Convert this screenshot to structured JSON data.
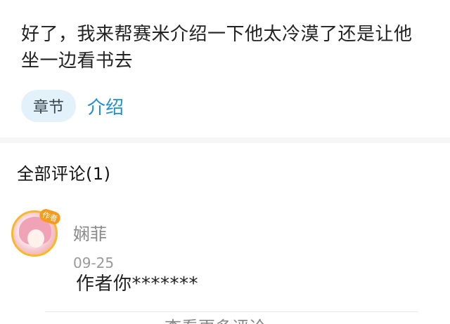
{
  "post": {
    "body_text": "好了，我来帮赛米介绍一下他太冷漠了还是让他坐一边看书去",
    "chapter_badge": "章节",
    "chapter_title": "介绍"
  },
  "comments": {
    "header": "全部评论(1)",
    "items": [
      {
        "username": "娴菲",
        "author_badge": "作者",
        "date": "09-25",
        "text": "作者你*******",
        "avatar_icon": "anime-girl-avatar"
      }
    ],
    "more_link": "查看更多评论"
  },
  "colors": {
    "accent": "#1f8fd0",
    "badge_bg": "#e3f1fb",
    "author_badge": "#f59b1e",
    "divider": "#f6f6f7"
  }
}
